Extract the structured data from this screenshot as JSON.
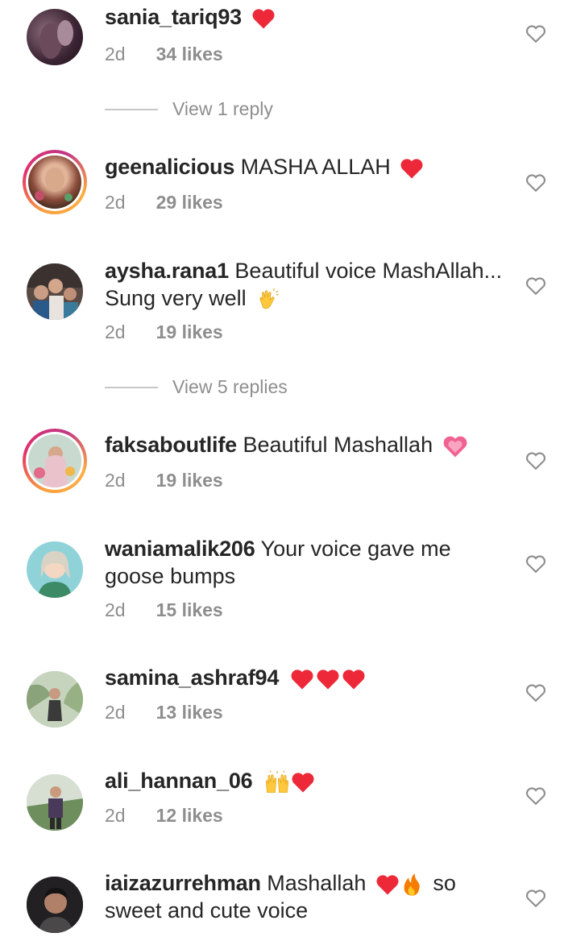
{
  "comments": [
    {
      "username": "sania_tariq93",
      "text": "",
      "emoji": [
        "red-heart"
      ],
      "age": "2d",
      "likes": "34 likes"
    },
    {
      "username": "geenalicious",
      "text": " MASHA ALLAH",
      "emoji": [
        "red-heart"
      ],
      "age": "2d",
      "likes": "29 likes"
    },
    {
      "username": "aysha.rana1",
      "text": " Beautiful voice MashAllah... Sung very well",
      "emoji": [
        "clapping-hands"
      ],
      "age": "2d",
      "likes": "19 likes"
    },
    {
      "username": "faksaboutlife",
      "text": " Beautiful Mashallah",
      "emoji": [
        "pink-heart"
      ],
      "age": "2d",
      "likes": "19 likes"
    },
    {
      "username": "waniamalik206",
      "text": " Your voice  gave me goose bumps",
      "emoji": [],
      "age": "2d",
      "likes": "15 likes"
    },
    {
      "username": "samina_ashraf94",
      "text": "",
      "emoji": [
        "red-heart",
        "red-heart",
        "red-heart"
      ],
      "age": "2d",
      "likes": "13 likes"
    },
    {
      "username": "ali_hannan_06",
      "text": "",
      "emoji": [
        "raising-hands",
        "red-heart"
      ],
      "age": "2d",
      "likes": "12 likes"
    },
    {
      "username": "iaizazurrehman",
      "text": " Mashallah",
      "emoji": [
        "red-heart",
        "fire"
      ],
      "text_after": "so sweet and cute voice",
      "age": "",
      "likes": ""
    }
  ],
  "replies": [
    {
      "label": "View 1 reply"
    },
    {
      "label": "View 5 replies"
    }
  ],
  "colors": {
    "muted": "#8e8e8e",
    "text": "#262626",
    "heart": "#ed2939",
    "divider": "#c7c7c7"
  }
}
